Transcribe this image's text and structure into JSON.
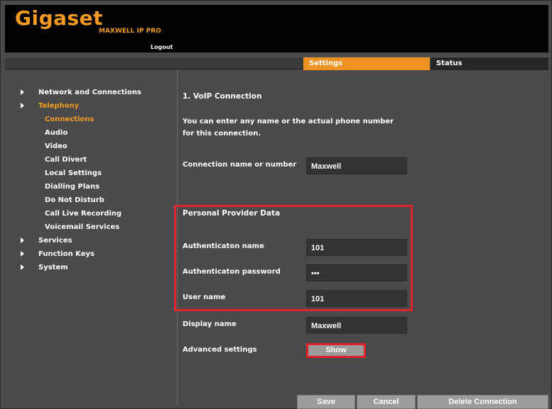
{
  "header": {
    "brand": "Gigaset",
    "model": "MAXWELL IP PRO",
    "logout": "Logout"
  },
  "tabs": [
    {
      "label": "Settings",
      "active": true
    },
    {
      "label": "Status",
      "active": false
    }
  ],
  "sidebar": {
    "items": [
      {
        "label": "Network and Connections",
        "level": 1,
        "arrow": true
      },
      {
        "label": "Telephony",
        "level": 1,
        "arrow": true,
        "active": true
      },
      {
        "label": "Connections",
        "level": 2,
        "active": true
      },
      {
        "label": "Audio",
        "level": 2
      },
      {
        "label": "Video",
        "level": 2
      },
      {
        "label": "Call Divert",
        "level": 2
      },
      {
        "label": "Local Settings",
        "level": 2
      },
      {
        "label": "Dialling Plans",
        "level": 2
      },
      {
        "label": "Do Not Disturb",
        "level": 2
      },
      {
        "label": "Call Live Recording",
        "level": 2
      },
      {
        "label": "Voicemail Services",
        "level": 2
      },
      {
        "label": "Services",
        "level": 1,
        "arrow": true
      },
      {
        "label": "Function Keys",
        "level": 1,
        "arrow": true
      },
      {
        "label": "System",
        "level": 1,
        "arrow": true
      }
    ]
  },
  "main": {
    "section_title": "1. VoIP Connection",
    "intro": "You can enter any name or the actual phone number for this connection.",
    "connection_name": {
      "label": "Connection name or number",
      "value": "Maxwell"
    },
    "provider_title": "Personal Provider Data",
    "auth_name": {
      "label": "Authenticaton name",
      "value": "101"
    },
    "auth_password": {
      "label": "Authenticaton password",
      "value": "•••"
    },
    "user_name": {
      "label": "User name",
      "value": "101"
    },
    "display_name": {
      "label": "Display name",
      "value": "Maxwell"
    },
    "advanced": {
      "label": "Advanced settings",
      "button": "Show"
    }
  },
  "footer": {
    "save": "Save",
    "cancel": "Cancel",
    "delete": "Delete Connection"
  },
  "colors": {
    "accent": "#ef9222",
    "highlight": "#e0242a",
    "background": "#4a4a4a"
  }
}
